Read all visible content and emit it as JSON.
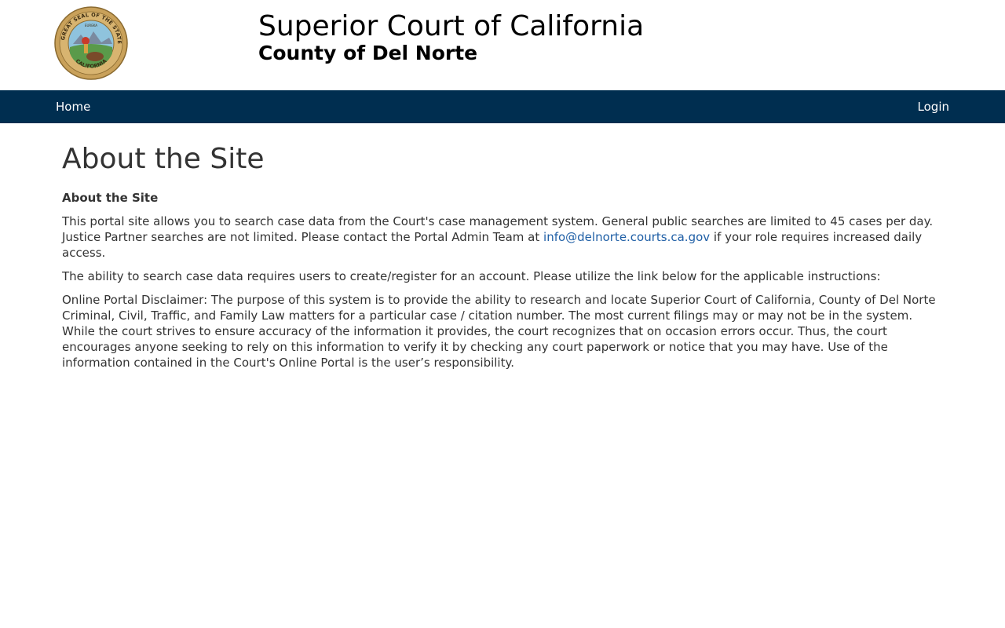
{
  "header": {
    "title": "Superior Court of California",
    "subtitle": "County of Del Norte",
    "seal": {
      "top_text": "THE GREAT SEAL OF THE STATE OF",
      "bottom_text": "CALIFORNIA",
      "motto": "EUREKA"
    }
  },
  "nav": {
    "home": "Home",
    "login": "Login"
  },
  "main": {
    "page_title": "About the Site",
    "section_heading": "About the Site",
    "p1_before": "This portal site allows you to search case data from the Court's case management system. General public searches are limited to 45 cases per day. Justice Partner searches are not limited. Please contact the Portal Admin Team at ",
    "p1_link": "info@delnorte.courts.ca.gov",
    "p1_after": " if your role requires increased daily access.",
    "p2": "The ability to search case data requires users to create/register for an account. Please utilize the link below for the applicable instructions:",
    "p3": "Online Portal Disclaimer: The purpose of this system is to provide the ability to research and locate Superior Court of California, County of Del Norte Criminal, Civil, Traffic, and Family Law matters for a particular case / citation number. The most current filings may or may not be in the system. While the court strives to ensure accuracy of the information it provides, the court recognizes that on occasion errors occur. Thus, the court encourages anyone seeking to rely on this information to verify it by checking any court paperwork or notice that you may have. Use of the information contained in the Court's Online Portal is the user’s responsibility."
  },
  "colors": {
    "navbar": "#002e50",
    "link": "#1f5fa6",
    "text": "#333333",
    "seal_gold": "#c9a15a"
  }
}
